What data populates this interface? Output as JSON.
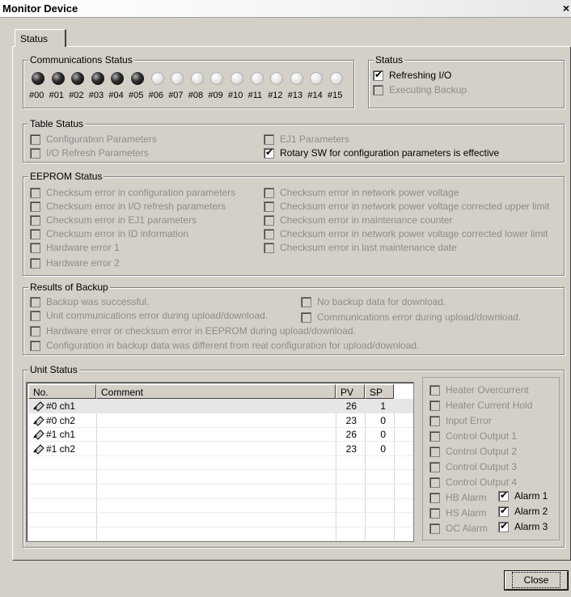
{
  "window": {
    "title": "Monitor Device",
    "close_glyph": "×"
  },
  "tabs": [
    {
      "label": "Status"
    }
  ],
  "comm_status": {
    "legend": "Communications Status",
    "nodes": [
      {
        "label": "#00",
        "state": "on"
      },
      {
        "label": "#01",
        "state": "on"
      },
      {
        "label": "#02",
        "state": "on"
      },
      {
        "label": "#03",
        "state": "on"
      },
      {
        "label": "#04",
        "state": "on"
      },
      {
        "label": "#05",
        "state": "on"
      },
      {
        "label": "#06",
        "state": "off"
      },
      {
        "label": "#07",
        "state": "off"
      },
      {
        "label": "#08",
        "state": "off"
      },
      {
        "label": "#09",
        "state": "off"
      },
      {
        "label": "#10",
        "state": "off"
      },
      {
        "label": "#11",
        "state": "off"
      },
      {
        "label": "#12",
        "state": "off"
      },
      {
        "label": "#13",
        "state": "off"
      },
      {
        "label": "#14",
        "state": "off"
      },
      {
        "label": "#15",
        "state": "off"
      }
    ]
  },
  "status": {
    "legend": "Status",
    "items": [
      {
        "label": "Refreshing I/O",
        "checked": true,
        "enabled": true
      },
      {
        "label": "Executing Backup",
        "checked": false,
        "enabled": false
      }
    ]
  },
  "table_status": {
    "legend": "Table Status",
    "items": [
      {
        "label": "Configuration Parameters",
        "checked": false,
        "enabled": false
      },
      {
        "label": "I/O Refresh Parameters",
        "checked": false,
        "enabled": false
      },
      {
        "label": "EJ1 Parameters",
        "checked": false,
        "enabled": false
      },
      {
        "label": "Rotary SW for configuration parameters is effective",
        "checked": true,
        "enabled": true
      }
    ]
  },
  "eeprom_status": {
    "legend": "EEPROM Status",
    "items": [
      {
        "label": "Checksum error in configuration parameters",
        "checked": false,
        "enabled": false
      },
      {
        "label": "Checksum error in I/O refresh parameters",
        "checked": false,
        "enabled": false
      },
      {
        "label": "Checksum error in EJ1 parameters",
        "checked": false,
        "enabled": false
      },
      {
        "label": "Checksum error in ID information",
        "checked": false,
        "enabled": false
      },
      {
        "label": "Hardware error 1",
        "checked": false,
        "enabled": false
      },
      {
        "label": "Hardware error 2",
        "checked": false,
        "enabled": false
      },
      {
        "label": "Checksum error in network power voltage",
        "checked": false,
        "enabled": false
      },
      {
        "label": "Checksum error in network power voltage corrected upper limit",
        "checked": false,
        "enabled": false
      },
      {
        "label": "Checksum error in maintenance counter",
        "checked": false,
        "enabled": false
      },
      {
        "label": "Checksum error in network power voltage corrected lower limit",
        "checked": false,
        "enabled": false
      },
      {
        "label": "Checksum error in last maintenance date",
        "checked": false,
        "enabled": false
      }
    ]
  },
  "backup_results": {
    "legend": "Results of Backup",
    "items": [
      {
        "label": "Backup was successful.",
        "checked": false,
        "enabled": false
      },
      {
        "label": "Unit communications error during upload/download.",
        "checked": false,
        "enabled": false
      },
      {
        "label": "Hardware error or checksum error in EEPROM during upload/download.",
        "checked": false,
        "enabled": false
      },
      {
        "label": "Configuration in backup data was different from real configuration for upload/download.",
        "checked": false,
        "enabled": false
      },
      {
        "label": "No backup data for download.",
        "checked": false,
        "enabled": false
      },
      {
        "label": "Communications error during upload/download.",
        "checked": false,
        "enabled": false
      }
    ]
  },
  "unit_status": {
    "legend": "Unit Status",
    "columns": [
      "No.",
      "Comment",
      "PV",
      "SP"
    ],
    "rows": [
      {
        "no": "#0 ch1",
        "comment": "",
        "pv": "26",
        "sp": "1",
        "selected": true
      },
      {
        "no": "#0 ch2",
        "comment": "",
        "pv": "23",
        "sp": "0",
        "selected": false
      },
      {
        "no": "#1 ch1",
        "comment": "",
        "pv": "26",
        "sp": "0",
        "selected": false
      },
      {
        "no": "#1 ch2",
        "comment": "",
        "pv": "23",
        "sp": "0",
        "selected": false
      }
    ],
    "flags": [
      {
        "label": "Heater Overcurrent",
        "checked": false,
        "enabled": false
      },
      {
        "label": "Heater Current Hold",
        "checked": false,
        "enabled": false
      },
      {
        "label": "Input Error",
        "checked": false,
        "enabled": false
      },
      {
        "label": "Control Output 1",
        "checked": false,
        "enabled": false
      },
      {
        "label": "Control Output 2",
        "checked": false,
        "enabled": false
      },
      {
        "label": "Control Output 3",
        "checked": false,
        "enabled": false
      },
      {
        "label": "Control Output 4",
        "checked": false,
        "enabled": false
      },
      {
        "label": "HB Alarm",
        "checked": false,
        "enabled": false
      },
      {
        "label": "HS Alarm",
        "checked": false,
        "enabled": false
      },
      {
        "label": "OC Alarm",
        "checked": false,
        "enabled": false
      },
      {
        "label": "Alarm 1",
        "checked": true,
        "enabled": true
      },
      {
        "label": "Alarm 2",
        "checked": true,
        "enabled": true
      },
      {
        "label": "Alarm 3",
        "checked": true,
        "enabled": true
      }
    ]
  },
  "buttons": {
    "close_label": "Close"
  },
  "icons": {
    "row_icon": "controller-icon",
    "checkmark": "✔"
  },
  "colors": {
    "dialog_bg": "#d4d0c8",
    "disabled_text": "#8c8c8c",
    "selected_row": "#e6e6e6"
  }
}
